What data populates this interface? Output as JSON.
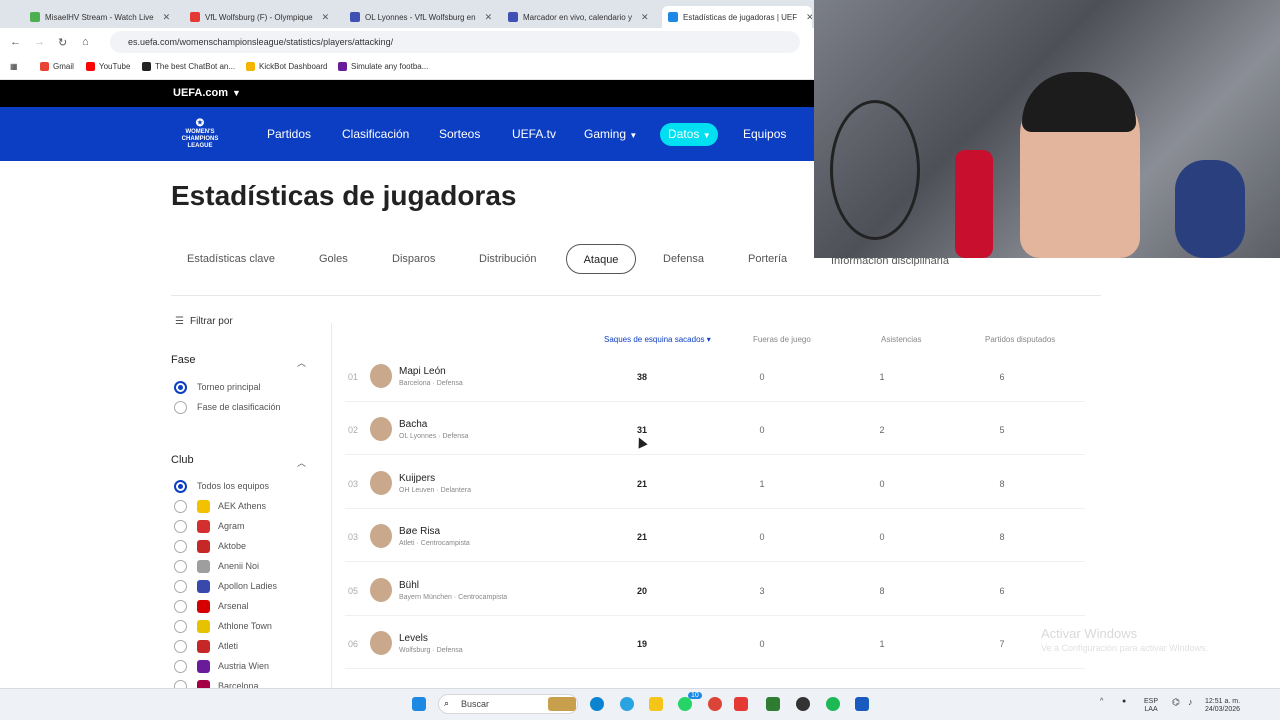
{
  "browser": {
    "tabs": [
      {
        "label": "MisaelHV Stream - Watch Live",
        "color": "#4caf50"
      },
      {
        "label": "VfL Wolfsburg (F) - Olympique",
        "color": "#e53935"
      },
      {
        "label": "OL Lyonnes - VfL Wolfsburg en",
        "color": "#3f51b5"
      },
      {
        "label": "Marcador en vivo, calendario y",
        "color": "#3f51b5"
      },
      {
        "label": "Estadísticas de jugadoras | UEF",
        "color": "#1e88e5"
      }
    ],
    "url": "es.uefa.com/womenschampionsleague/statistics/players/attacking/",
    "bookmarks": [
      {
        "label": "Gmail",
        "color": "#ea4335"
      },
      {
        "label": "YouTube",
        "color": "#ff0000"
      },
      {
        "label": "The best ChatBot an...",
        "color": "#222222"
      },
      {
        "label": "KickBot Dashboard",
        "color": "#f4b400"
      },
      {
        "label": "Simulate any footba...",
        "color": "#6a1b9a"
      }
    ]
  },
  "site": {
    "top_label": "UEFA.com",
    "logo_lines": [
      "WOMEN'S",
      "CHAMPIONS",
      "LEAGUE"
    ],
    "nav": [
      "Partidos",
      "Clasificación",
      "Sorteos",
      "UEFA.tv",
      "Gaming",
      "Datos",
      "Equipos"
    ],
    "accent": "#0c3ec3",
    "pill_color": "#00e0f0"
  },
  "page": {
    "title": "Estadísticas de jugadoras",
    "tabs": [
      "Estadísticas clave",
      "Goles",
      "Disparos",
      "Distribución",
      "Ataque",
      "Defensa",
      "Portería",
      "Información disciplinaria"
    ],
    "active_tab": "Ataque"
  },
  "filters": {
    "label": "Filtrar por",
    "fase": {
      "title": "Fase",
      "options": [
        "Torneo principal",
        "Fase de clasificación"
      ],
      "selected": "Torneo principal"
    },
    "club": {
      "title": "Club",
      "options": [
        {
          "name": "Todos los equipos",
          "color": ""
        },
        {
          "name": "AEK Athens",
          "color": "#f2c200"
        },
        {
          "name": "Agram",
          "color": "#d32f2f"
        },
        {
          "name": "Aktobe",
          "color": "#c62828"
        },
        {
          "name": "Anenii Noi",
          "color": "#9e9e9e"
        },
        {
          "name": "Apollon Ladies",
          "color": "#3949ab"
        },
        {
          "name": "Arsenal",
          "color": "#d50000"
        },
        {
          "name": "Athlone Town",
          "color": "#e6c200"
        },
        {
          "name": "Atleti",
          "color": "#c62828"
        },
        {
          "name": "Austria Wien",
          "color": "#6a1b9a"
        },
        {
          "name": "Barcelona",
          "color": "#a50044"
        }
      ],
      "selected": "Todos los equipos"
    }
  },
  "table": {
    "headers": [
      "Saques de esquina sacados",
      "Fueras de juego",
      "Asistencias",
      "Partidos disputados"
    ],
    "sorted_header": "Saques de esquina sacados",
    "rows": [
      {
        "rank": "01",
        "name": "Mapi León",
        "sub": "Barcelona · Defensa",
        "corners": "38",
        "offsides": "0",
        "assists": "1",
        "played": "6"
      },
      {
        "rank": "02",
        "name": "Bacha",
        "sub": "OL Lyonnes · Defensa",
        "corners": "31",
        "offsides": "0",
        "assists": "2",
        "played": "5"
      },
      {
        "rank": "03",
        "name": "Kuijpers",
        "sub": "OH Leuven · Delantera",
        "corners": "21",
        "offsides": "1",
        "assists": "0",
        "played": "8"
      },
      {
        "rank": "03",
        "name": "Bøe Risa",
        "sub": "Atleti · Centrocampista",
        "corners": "21",
        "offsides": "0",
        "assists": "0",
        "played": "8"
      },
      {
        "rank": "05",
        "name": "Bühl",
        "sub": "Bayern München · Centrocampista",
        "corners": "20",
        "offsides": "3",
        "assists": "8",
        "played": "6"
      },
      {
        "rank": "06",
        "name": "Levels",
        "sub": "Wolfsburg · Defensa",
        "corners": "19",
        "offsides": "0",
        "assists": "1",
        "played": "7"
      }
    ]
  },
  "watermark": {
    "line1": "Activar Windows",
    "line2": "Ve a Configuración para activar Windows."
  },
  "taskbar": {
    "search": "Buscar",
    "lang": "ESP",
    "lang2": "LAA",
    "time": "12:51 a. m.",
    "date": "24/03/2026",
    "badge": "10"
  }
}
